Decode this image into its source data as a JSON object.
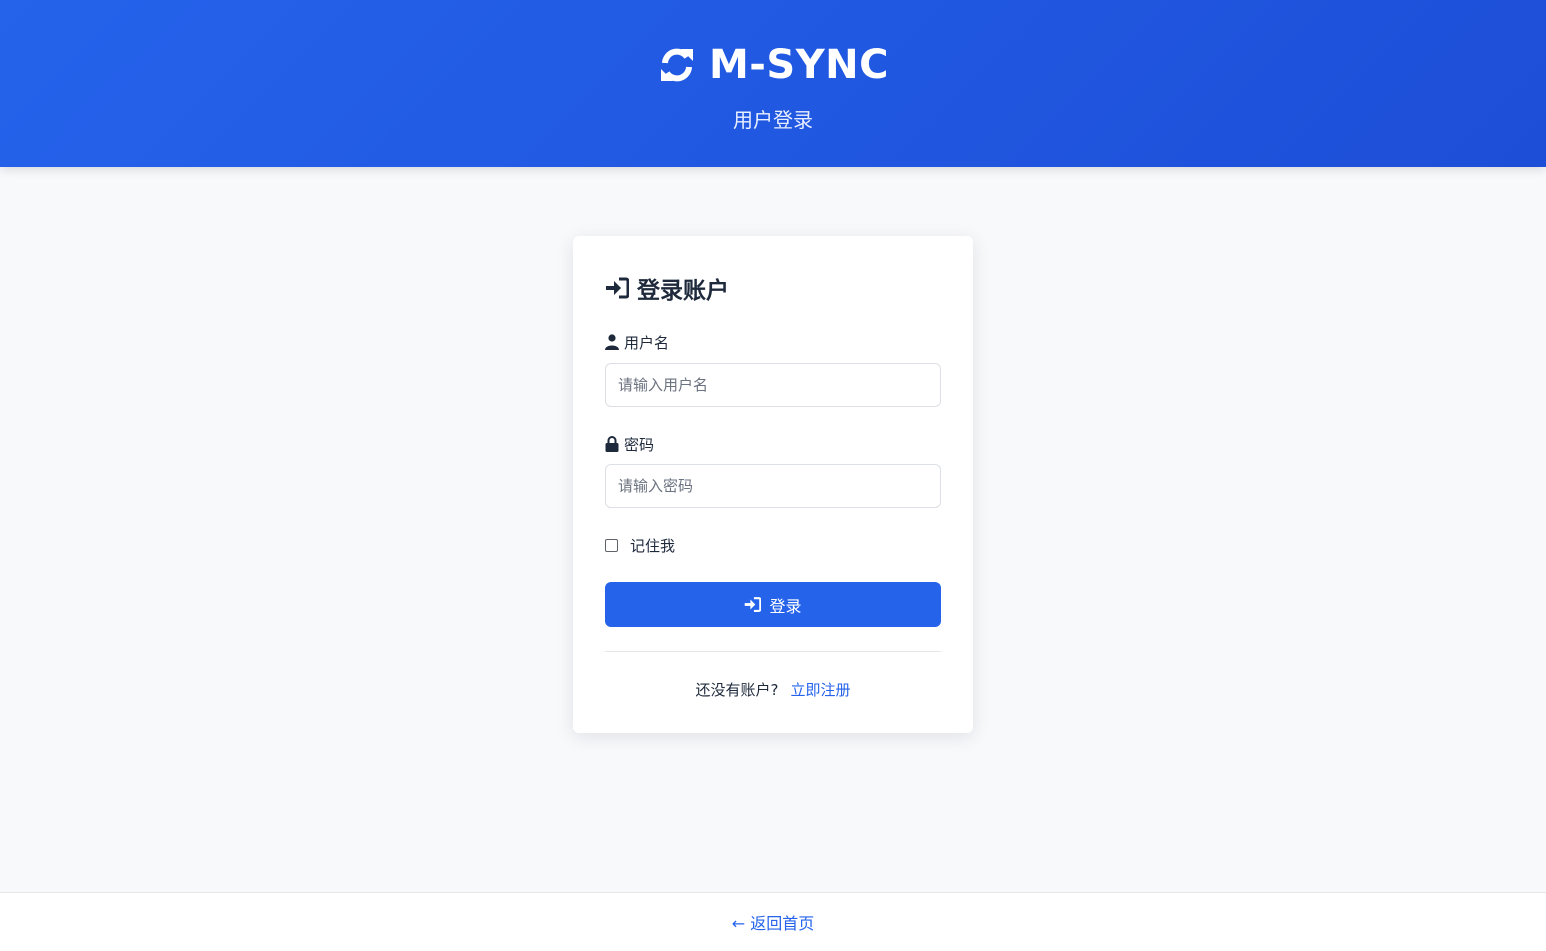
{
  "header": {
    "app_title": "M-SYNC",
    "subtitle": "用户登录",
    "icon": "sync-icon"
  },
  "login_card": {
    "title": "登录账户",
    "title_icon": "sign-in-icon",
    "username": {
      "label": "用户名",
      "icon": "user-icon",
      "value": "",
      "placeholder": "请输入用户名"
    },
    "password": {
      "label": "密码",
      "icon": "lock-icon",
      "value": "",
      "placeholder": "请输入密码"
    },
    "remember_me": {
      "label": "记住我",
      "checked": false
    },
    "submit_button": {
      "label": "登录",
      "icon": "sign-in-icon"
    },
    "register_prompt": "还没有账户?",
    "register_link": "立即注册"
  },
  "footer": {
    "back_home_link": "← 返回首页"
  },
  "colors": {
    "primary": "#2563eb",
    "header_gradient_end": "#1d4ed8",
    "page_background": "#f8f9fb",
    "text": "#1e293b"
  }
}
